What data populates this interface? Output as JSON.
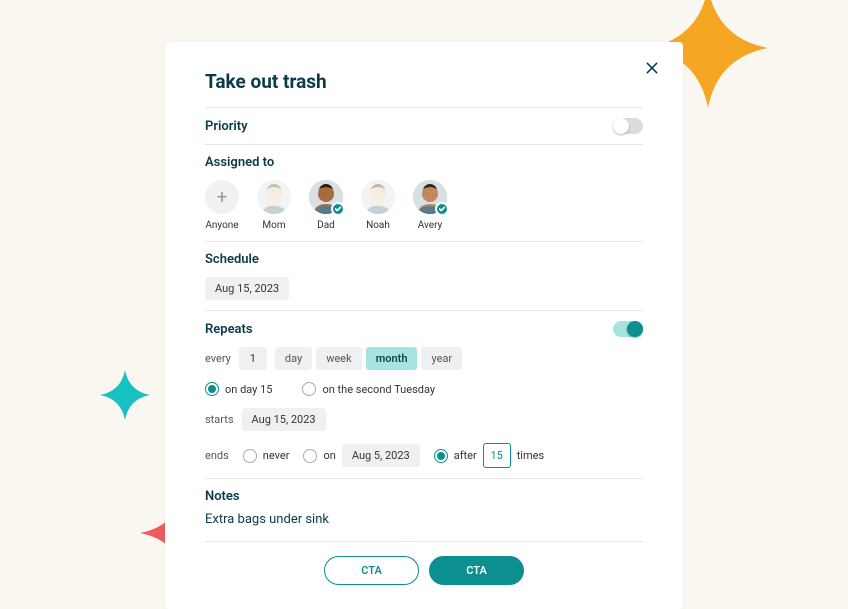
{
  "title": "Take out trash",
  "priority": {
    "label": "Priority",
    "on": false
  },
  "assigned": {
    "label": "Assigned to",
    "people": [
      {
        "name": "Anyone",
        "type": "anyone",
        "selected": false
      },
      {
        "name": "Mom",
        "type": "avatar",
        "selected": false,
        "faded": true,
        "skin": "#e8c9a8",
        "hair": "#6b4a2e"
      },
      {
        "name": "Dad",
        "type": "avatar",
        "selected": true,
        "faded": false,
        "skin": "#a86b3e",
        "hair": "#2b1d12"
      },
      {
        "name": "Noah",
        "type": "avatar",
        "selected": false,
        "faded": true,
        "skin": "#e8c9a8",
        "hair": "#4a3420"
      },
      {
        "name": "Avery",
        "type": "avatar",
        "selected": true,
        "faded": false,
        "skin": "#c18a5e",
        "hair": "#3a2418"
      }
    ]
  },
  "schedule": {
    "label": "Schedule",
    "date": "Aug 15, 2023"
  },
  "repeats": {
    "label": "Repeats",
    "on": true,
    "every_label": "every",
    "every_value": "1",
    "units": [
      {
        "label": "day",
        "active": false
      },
      {
        "label": "week",
        "active": false
      },
      {
        "label": "month",
        "active": true
      },
      {
        "label": "year",
        "active": false
      }
    ],
    "monthly_options": [
      {
        "label": "on day 15",
        "selected": true
      },
      {
        "label": "on the second Tuesday",
        "selected": false
      }
    ],
    "starts_label": "starts",
    "starts_date": "Aug 15, 2023",
    "ends_label": "ends",
    "ends_options": {
      "never": {
        "label": "never",
        "selected": false
      },
      "on": {
        "label": "on",
        "selected": false,
        "date": "Aug 5, 2023"
      },
      "after": {
        "label": "after",
        "selected": true,
        "count": "15",
        "suffix": "times"
      }
    }
  },
  "notes": {
    "label": "Notes",
    "text": "Extra bags under sink"
  },
  "buttons": {
    "secondary": "CTA",
    "primary": "CTA"
  },
  "colors": {
    "accent": "#0c8f8f",
    "brand_text": "#0a3b4a"
  }
}
